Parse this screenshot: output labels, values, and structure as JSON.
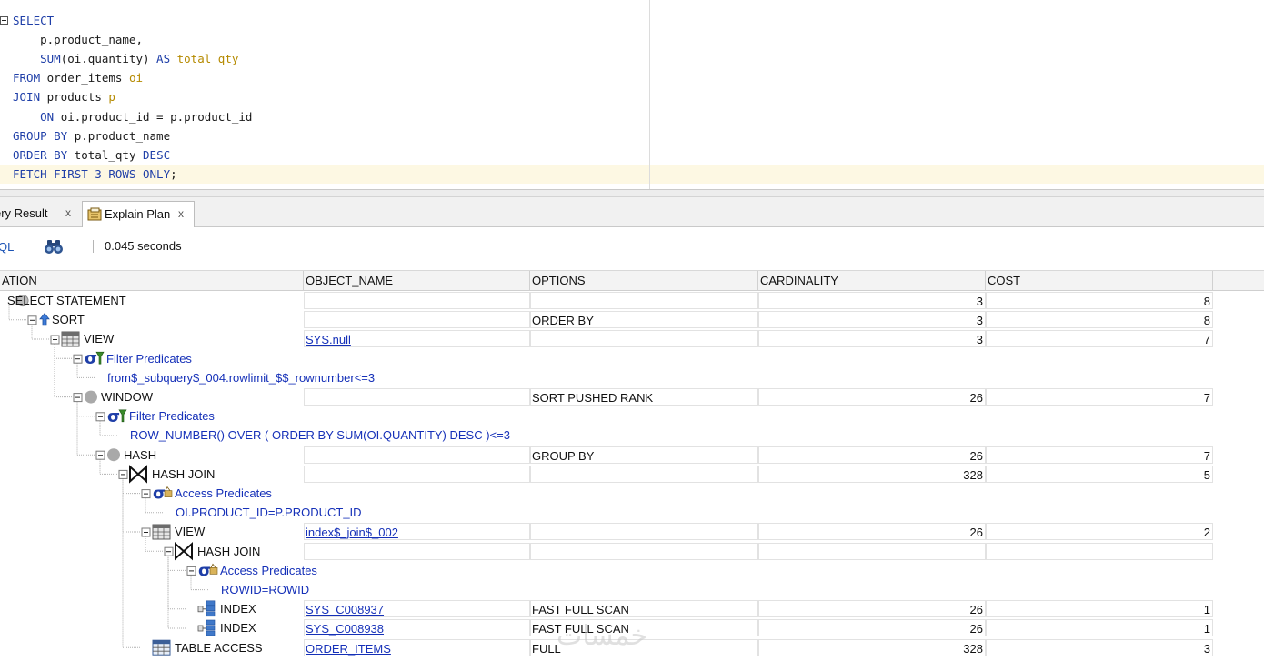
{
  "editor": {
    "lines": [
      [
        {
          "t": "SELECT",
          "k": "kw"
        }
      ],
      [
        {
          "t": "    p.product_name,",
          "k": ""
        }
      ],
      [
        {
          "t": "    ",
          "k": ""
        },
        {
          "t": "SUM",
          "k": "kw"
        },
        {
          "t": "(oi.quantity) ",
          "k": ""
        },
        {
          "t": "AS",
          "k": "kw"
        },
        {
          "t": " total_qty",
          "k": "al"
        }
      ],
      [
        {
          "t": "FROM",
          "k": "kw"
        },
        {
          "t": " order_items ",
          "k": ""
        },
        {
          "t": "oi",
          "k": "al"
        }
      ],
      [
        {
          "t": "JOIN",
          "k": "kw"
        },
        {
          "t": " products ",
          "k": ""
        },
        {
          "t": "p",
          "k": "al"
        }
      ],
      [
        {
          "t": "    ",
          "k": ""
        },
        {
          "t": "ON",
          "k": "kw"
        },
        {
          "t": " oi.product_id = p.product_id",
          "k": ""
        }
      ],
      [
        {
          "t": "GROUP BY",
          "k": "kw"
        },
        {
          "t": " p.product_name",
          "k": ""
        }
      ],
      [
        {
          "t": "ORDER BY",
          "k": "kw"
        },
        {
          "t": " total_qty ",
          "k": ""
        },
        {
          "t": "DESC",
          "k": "kw"
        }
      ],
      [
        {
          "t": "FETCH FIRST 3 ROWS ONLY",
          "k": "kw"
        },
        {
          "t": ";",
          "k": ""
        }
      ]
    ]
  },
  "tabs": {
    "query_result": {
      "label": "ery Result",
      "close": "x"
    },
    "explain_plan": {
      "label": "Explain Plan",
      "close": "x"
    }
  },
  "toolbar": {
    "sql_label": "QL",
    "elapsed": "0.045 seconds"
  },
  "grid": {
    "columns": [
      "ATION",
      "OBJECT_NAME",
      "OPTIONS",
      "CARDINALITY",
      "COST"
    ],
    "rows": [
      {
        "op": "SELECT STATEMENT",
        "icon": "circle-icon",
        "obj": "",
        "opt": "",
        "card": "3",
        "cost": "8",
        "boxed": true
      },
      {
        "op": "SORT",
        "icon": "sort-icon",
        "obj": "",
        "opt": "ORDER BY",
        "card": "3",
        "cost": "8",
        "boxed": true
      },
      {
        "op": "VIEW",
        "icon": "view-icon",
        "obj": "SYS.null",
        "opt": "",
        "card": "3",
        "cost": "7",
        "boxed": true
      },
      {
        "op": "Filter Predicates",
        "icon": "filter-predicate-icon",
        "pred": true,
        "boxed": false
      },
      {
        "op": "from$_subquery$_004.rowlimit_$$_rownumber<=3",
        "pred": true,
        "boxed": false
      },
      {
        "op": "WINDOW",
        "icon": "gray-circle-icon",
        "obj": "",
        "opt": "SORT PUSHED RANK",
        "card": "26",
        "cost": "7",
        "boxed": true
      },
      {
        "op": "Filter Predicates",
        "icon": "filter-predicate-icon",
        "pred": true,
        "boxed": false
      },
      {
        "op": "ROW_NUMBER() OVER ( ORDER BY SUM(OI.QUANTITY) DESC )<=3",
        "pred": true,
        "boxed": false
      },
      {
        "op": "HASH",
        "icon": "gray-circle-icon",
        "obj": "",
        "opt": "GROUP BY",
        "card": "26",
        "cost": "7",
        "boxed": true
      },
      {
        "op": "HASH JOIN",
        "icon": "join-icon",
        "obj": "",
        "opt": "",
        "card": "328",
        "cost": "5",
        "boxed": true
      },
      {
        "op": "Access Predicates",
        "icon": "access-predicate-icon",
        "pred": true,
        "boxed": false
      },
      {
        "op": "OI.PRODUCT_ID=P.PRODUCT_ID",
        "pred": true,
        "boxed": false
      },
      {
        "op": "VIEW",
        "icon": "view-icon",
        "obj": "index$_join$_002",
        "opt": "",
        "card": "26",
        "cost": "2",
        "boxed": true
      },
      {
        "op": "HASH JOIN",
        "icon": "join-icon",
        "obj": "",
        "opt": "",
        "card": "",
        "cost": "",
        "boxed": true
      },
      {
        "op": "Access Predicates",
        "icon": "access-predicate-icon",
        "pred": true,
        "boxed": false
      },
      {
        "op": "ROWID=ROWID",
        "pred": true,
        "boxed": false
      },
      {
        "op": "INDEX",
        "icon": "index-icon",
        "obj": "SYS_C008937",
        "opt": "FAST FULL SCAN",
        "card": "26",
        "cost": "1",
        "boxed": true
      },
      {
        "op": "INDEX",
        "icon": "index-icon",
        "obj": "SYS_C008938",
        "opt": "FAST FULL SCAN",
        "card": "26",
        "cost": "1",
        "boxed": true
      },
      {
        "op": "TABLE ACCESS",
        "icon": "table-icon",
        "obj": "ORDER_ITEMS",
        "opt": "FULL",
        "card": "328",
        "cost": "3",
        "boxed": true
      }
    ]
  },
  "watermark": "خمسات",
  "colors": {
    "keyword": "#1f3fa8",
    "alias": "#b58a00",
    "link": "#1530b8",
    "current_line": "#fdf8e3"
  }
}
